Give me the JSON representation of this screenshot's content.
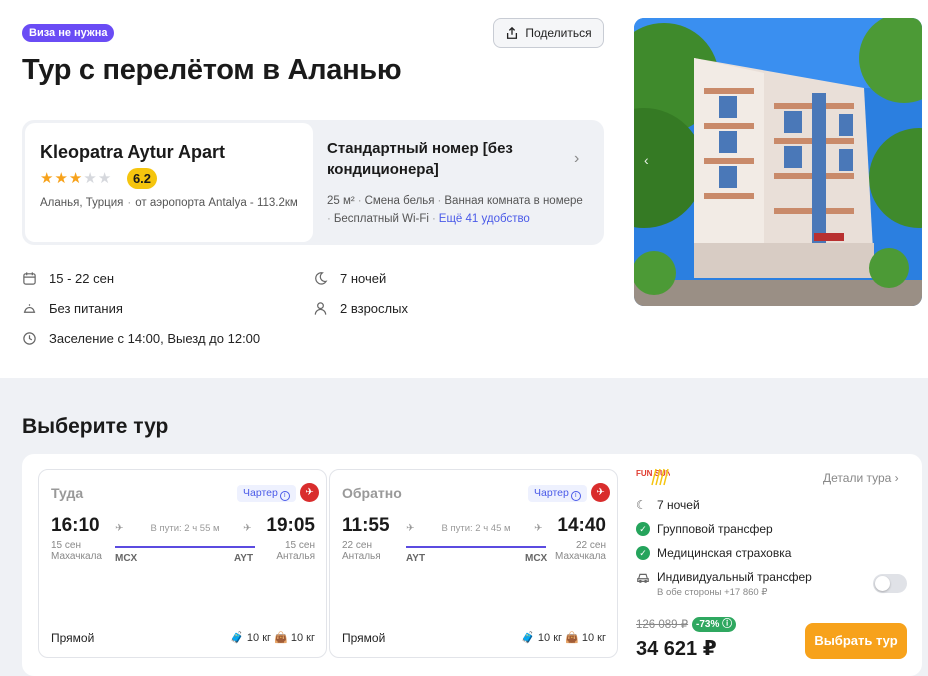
{
  "header": {
    "visa_badge": "Виза не нужна",
    "title": "Тур с перелётом в Аланью",
    "share_label": "Поделиться"
  },
  "hotel": {
    "name": "Kleopatra Aytur Apart",
    "stars": 3,
    "stars_max": 5,
    "rating": "6.2",
    "location": "Аланья, Турция",
    "airport": "от аэропорта Antalya - 113.2км"
  },
  "room": {
    "title": "Стандартный номер [без кондиционера]",
    "amenities": [
      "25 м²",
      "Смена белья",
      "Ванная комната в номере",
      "Бесплатный Wi-Fi"
    ],
    "more_link": "Ещё 41 удобство"
  },
  "details": {
    "dates": "15 - 22 сен",
    "nights": "7 ночей",
    "meal": "Без питания",
    "guests": "2 взрослых",
    "checkin": "Заселение с 14:00, Выезд до 12:00"
  },
  "select_section": {
    "title": "Выберите тур"
  },
  "flights": [
    {
      "title": "Туда",
      "charter": "Чартер",
      "dep_time": "16:10",
      "dep_date": "15 сен",
      "dep_city": "Махачкала",
      "duration": "В пути: 2 ч 55 м",
      "dep_code": "MCX",
      "arr_code": "AYT",
      "arr_time": "19:05",
      "arr_date": "15 сен",
      "arr_city": "Анталья",
      "type": "Прямой",
      "bag1": "10 кг",
      "bag2": "10 кг"
    },
    {
      "title": "Обратно",
      "charter": "Чартер",
      "dep_time": "11:55",
      "dep_date": "22 сен",
      "dep_city": "Анталья",
      "duration": "В пути: 2 ч 45 м",
      "dep_code": "AYT",
      "arr_code": "MCX",
      "arr_time": "14:40",
      "arr_date": "22 сен",
      "arr_city": "Махачкала",
      "type": "Прямой",
      "bag1": "10 кг",
      "bag2": "10 кг"
    }
  ],
  "offer": {
    "operator_text": "FUN SUN",
    "details_link": "Детали тура",
    "features": [
      "7 ночей",
      "Групповой трансфер",
      "Медицинская страховка"
    ],
    "individual_transfer": "Индивидуальный трансфер",
    "transfer_sub": "В обе стороны +17 860 ₽",
    "old_price": "126 089 ₽",
    "discount": "-73%",
    "price": "34 621 ₽",
    "choose_label": "Выбрать тур"
  },
  "colors": {
    "accent": "#6a4cf5",
    "button": "#f7a21b",
    "check": "#25a45c",
    "route": "#5b4be0"
  }
}
